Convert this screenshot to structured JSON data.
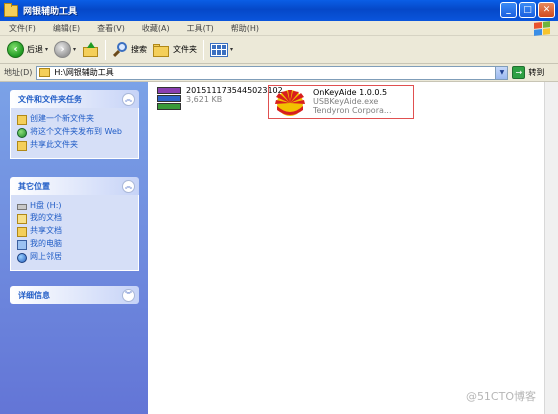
{
  "window": {
    "title": "网银辅助工具"
  },
  "window_buttons": {
    "minimize": "_",
    "maximize": "□",
    "close": "✕"
  },
  "menu": [
    "文件(F)",
    "编辑(E)",
    "查看(V)",
    "收藏(A)",
    "工具(T)",
    "帮助(H)"
  ],
  "toolbar": {
    "back_label": "后退",
    "search_label": "搜索",
    "folders_label": "文件夹"
  },
  "address": {
    "label": "地址(D)",
    "path": "H:\\网银辅助工具",
    "go_label": "转到"
  },
  "tasks_panel": {
    "title": "文件和文件夹任务",
    "items": [
      "创建一个新文件夹",
      "将这个文件夹发布到 Web",
      "共享此文件夹"
    ]
  },
  "places_panel": {
    "title": "其它位置",
    "items": [
      "H盘 (H:)",
      "我的文档",
      "共享文档",
      "我的电脑",
      "网上邻居"
    ]
  },
  "details_panel": {
    "title": "详细信息"
  },
  "files": [
    {
      "name": "2015111735445023102",
      "size": "3,621 KB"
    },
    {
      "name": "OnKeyAide 1.0.0.5",
      "desc": "USBKeyAide.exe",
      "company": "Tendyron Corpora..."
    }
  ],
  "watermark": "@51CTO博客",
  "colors": {
    "titlebar": "#0548c8",
    "left_pane": "#6f8fe0",
    "link": "#215dc6",
    "selection_box": "#e05050"
  }
}
